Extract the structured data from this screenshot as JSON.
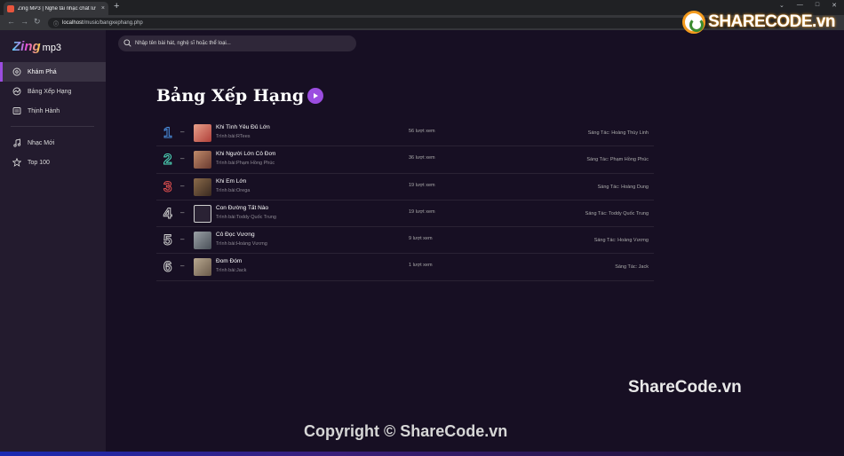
{
  "browser": {
    "tab_title": "Zing MP3 | Nghe tải nhạc chất lư",
    "tab_close": "×",
    "new_tab": "+",
    "url_host": "localhost",
    "url_path": "/music/bangxephang.php"
  },
  "watermark": {
    "logo_text": "SHARECODE.vn",
    "mid_text": "ShareCode.vn",
    "copyright": "Copyright © ShareCode.vn"
  },
  "sidebar": {
    "logo_zing": "Zing",
    "logo_mp3": "mp3",
    "items": [
      {
        "label": "Khám Phá",
        "icon": "disc-icon"
      },
      {
        "label": "Bảng Xếp Hạng",
        "icon": "chart-icon"
      },
      {
        "label": "Thịnh Hành",
        "icon": "list-icon"
      },
      {
        "label": "Nhạc Mới",
        "icon": "music-note-icon"
      },
      {
        "label": "Top 100",
        "icon": "star-icon"
      }
    ]
  },
  "search": {
    "placeholder": "Nhập tên bài hát, nghệ sĩ hoặc thể loại..."
  },
  "page": {
    "title": "Bảng Xếp Hạng"
  },
  "ranking": [
    {
      "rank": "1",
      "dash": "–",
      "song": "Khi Tình Yêu Đủ Lớn",
      "artist": "Trình bài:RTees",
      "views": "56 lượt xem",
      "composer": "Sáng Tác: Hoàng Thùy Linh",
      "rank_color": "#4a90e2",
      "thumb": [
        "#e8a08a",
        "#b0403a"
      ]
    },
    {
      "rank": "2",
      "dash": "–",
      "song": "Khi Người Lớn Cô Đơn",
      "artist": "Trình bài:Phạm Hồng Phúc",
      "views": "36 lượt xem",
      "composer": "Sáng Tác: Phạm Hồng Phúc",
      "rank_color": "#50e3c2",
      "thumb": [
        "#c08a6a",
        "#6a3a30"
      ]
    },
    {
      "rank": "3",
      "dash": "–",
      "song": "Khi Em Lớn",
      "artist": "Trình bài:Orega",
      "views": "19 lượt xem",
      "composer": "Sáng Tác: Hoàng Dung",
      "rank_color": "#e35050",
      "thumb": [
        "#8a6a4a",
        "#3a2a20"
      ]
    },
    {
      "rank": "4",
      "dash": "–",
      "song": "Con Đường Tất Nào",
      "artist": "Trình bài:Toddy Quốc Trung",
      "views": "19 lượt xem",
      "composer": "Sáng Tác: Toddy Quốc Trung",
      "rank_color": "#cccccc",
      "thumb": [
        "#2a2234",
        "#2a2234"
      ]
    },
    {
      "rank": "5",
      "dash": "–",
      "song": "Cô Đọc Vương",
      "artist": "Trình bài:Hoàng Vương",
      "views": "9 lượt xem",
      "composer": "Sáng Tác: Hoàng Vương",
      "rank_color": "#cccccc",
      "thumb": [
        "#9aa0a6",
        "#4a5058"
      ]
    },
    {
      "rank": "6",
      "dash": "–",
      "song": "Đom Đóm",
      "artist": "Trình bài:Jack",
      "views": "1 lượt xem",
      "composer": "Sáng Tác: Jack",
      "rank_color": "#cccccc",
      "thumb": [
        "#b8a890",
        "#6a5a4a"
      ]
    }
  ]
}
